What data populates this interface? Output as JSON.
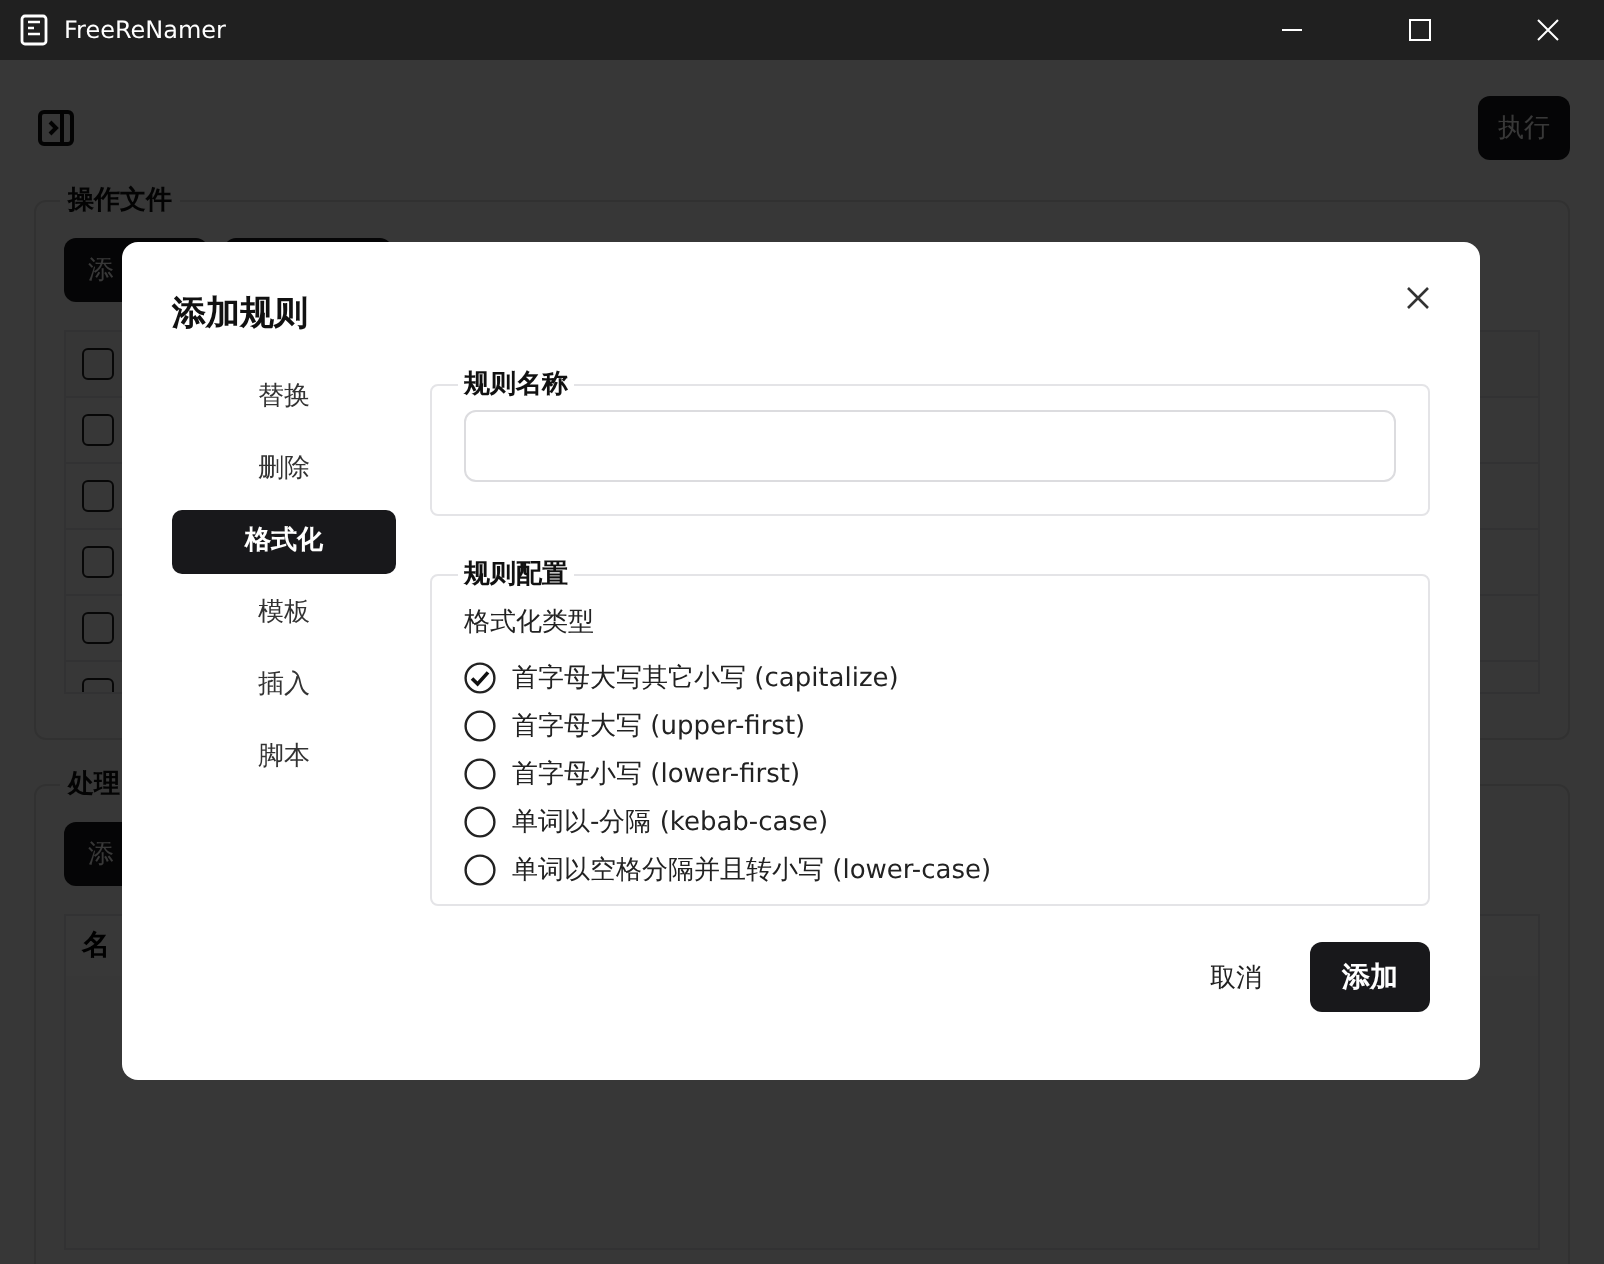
{
  "window": {
    "title": "FreeReNamer"
  },
  "toolbar": {
    "execute_button": "执行"
  },
  "files_section": {
    "title": "操作文件",
    "add_button": "添",
    "header_checked": false,
    "rows": [
      {
        "checked": false
      },
      {
        "checked": false
      },
      {
        "checked": false
      },
      {
        "checked": false
      },
      {
        "checked": false
      }
    ]
  },
  "process_section": {
    "title": "处理",
    "add_button": "添",
    "column_1": "名"
  },
  "dialog": {
    "title": "添加规则",
    "rule_types": [
      {
        "label": "替换",
        "selected": false
      },
      {
        "label": "删除",
        "selected": false
      },
      {
        "label": "格式化",
        "selected": true
      },
      {
        "label": "模板",
        "selected": false
      },
      {
        "label": "插入",
        "selected": false
      },
      {
        "label": "脚本",
        "selected": false
      }
    ],
    "name_group": {
      "legend": "规则名称"
    },
    "config_group": {
      "legend": "规则配置",
      "field_label": "格式化类型",
      "options": [
        {
          "label": "首字母大写其它小写 (capitalize)",
          "selected": true
        },
        {
          "label": "首字母大写 (upper-first)",
          "selected": false
        },
        {
          "label": "首字母小写 (lower-first)",
          "selected": false
        },
        {
          "label": "单词以-分隔 (kebab-case)",
          "selected": false
        },
        {
          "label": "单词以空格分隔并且转小写 (lower-case)",
          "selected": false
        }
      ]
    },
    "cancel_button": "取消",
    "confirm_button": "添加"
  }
}
